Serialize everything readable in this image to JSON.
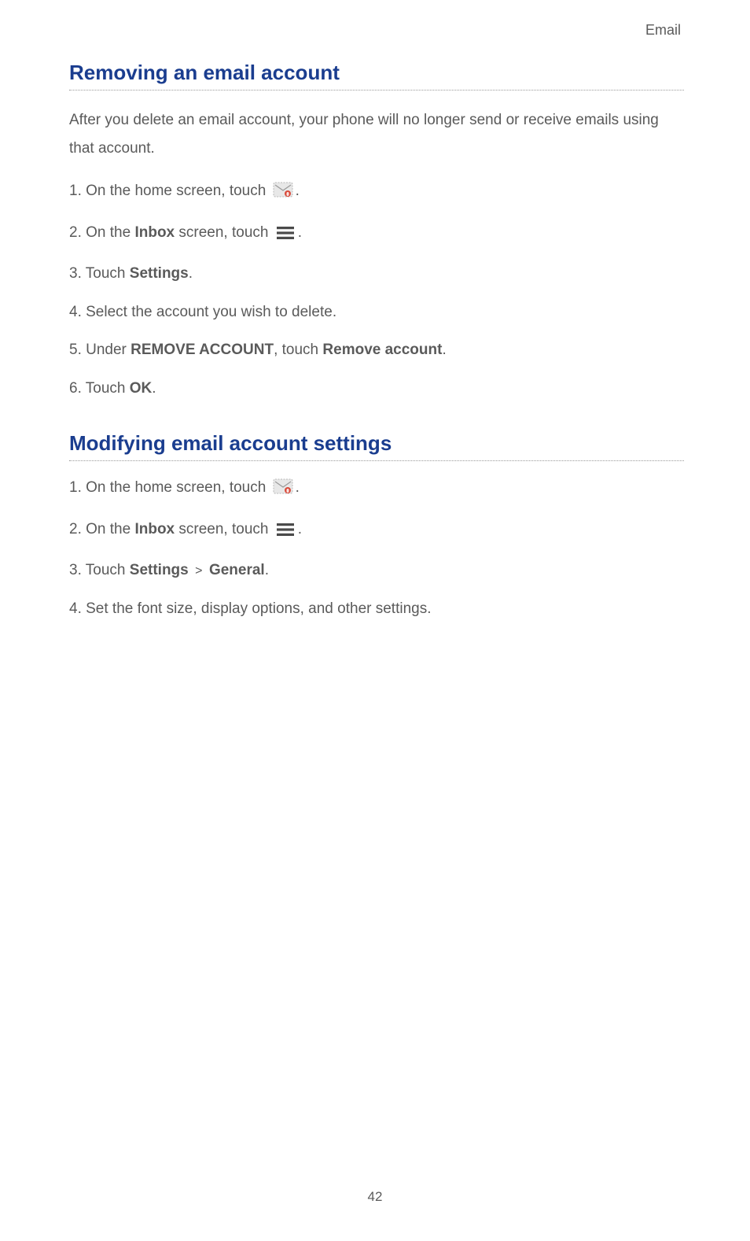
{
  "header": {
    "label": "Email"
  },
  "section1": {
    "heading": "Removing an email account",
    "intro": "After you delete an email account, your phone will no longer send or receive emails using that account.",
    "steps": {
      "s1a": "On the home screen, touch ",
      "s1b": ".",
      "s2a": "On the ",
      "s2b": "Inbox",
      "s2c": " screen, touch ",
      "s2d": ".",
      "s3a": "Touch ",
      "s3b": "Settings",
      "s3c": ".",
      "s4": "Select the account you wish to delete.",
      "s5a": "Under ",
      "s5b": "REMOVE ACCOUNT",
      "s5c": ", touch ",
      "s5d": "Remove account",
      "s5e": ".",
      "s6a": "Touch ",
      "s6b": "OK",
      "s6c": "."
    }
  },
  "section2": {
    "heading": "Modifying email account settings",
    "steps": {
      "s1a": "On the home screen, touch ",
      "s1b": ".",
      "s2a": "On the ",
      "s2b": "Inbox",
      "s2c": " screen, touch ",
      "s2d": ".",
      "s3a": "Touch ",
      "s3b": "Settings",
      "s3c": " > ",
      "s3d": "General",
      "s3e": ".",
      "s4": "Set the font size, display options, and other settings."
    }
  },
  "page_number": "42"
}
